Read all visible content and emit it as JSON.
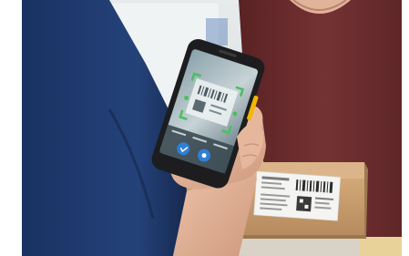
{
  "photo": {
    "subject": "handheld-barcode-scanner-in-use",
    "colors": {
      "background_wall": "#dde3e5",
      "whiteboard": "#eef1f2",
      "sleeve_blue": "#1e3a6e",
      "shirt_maroon": "#6a2c2e",
      "skin": "#e4b49a",
      "phone_body": "#1d1d1f",
      "phone_accent": "#f2b705",
      "screen_base": "#6e8590",
      "scan_frame": "#48c060",
      "box_cardboard": "#c49a6c",
      "label_paper": "#f3f3f1"
    },
    "icons": [
      "scan-button-icon",
      "camera-button-icon"
    ]
  }
}
